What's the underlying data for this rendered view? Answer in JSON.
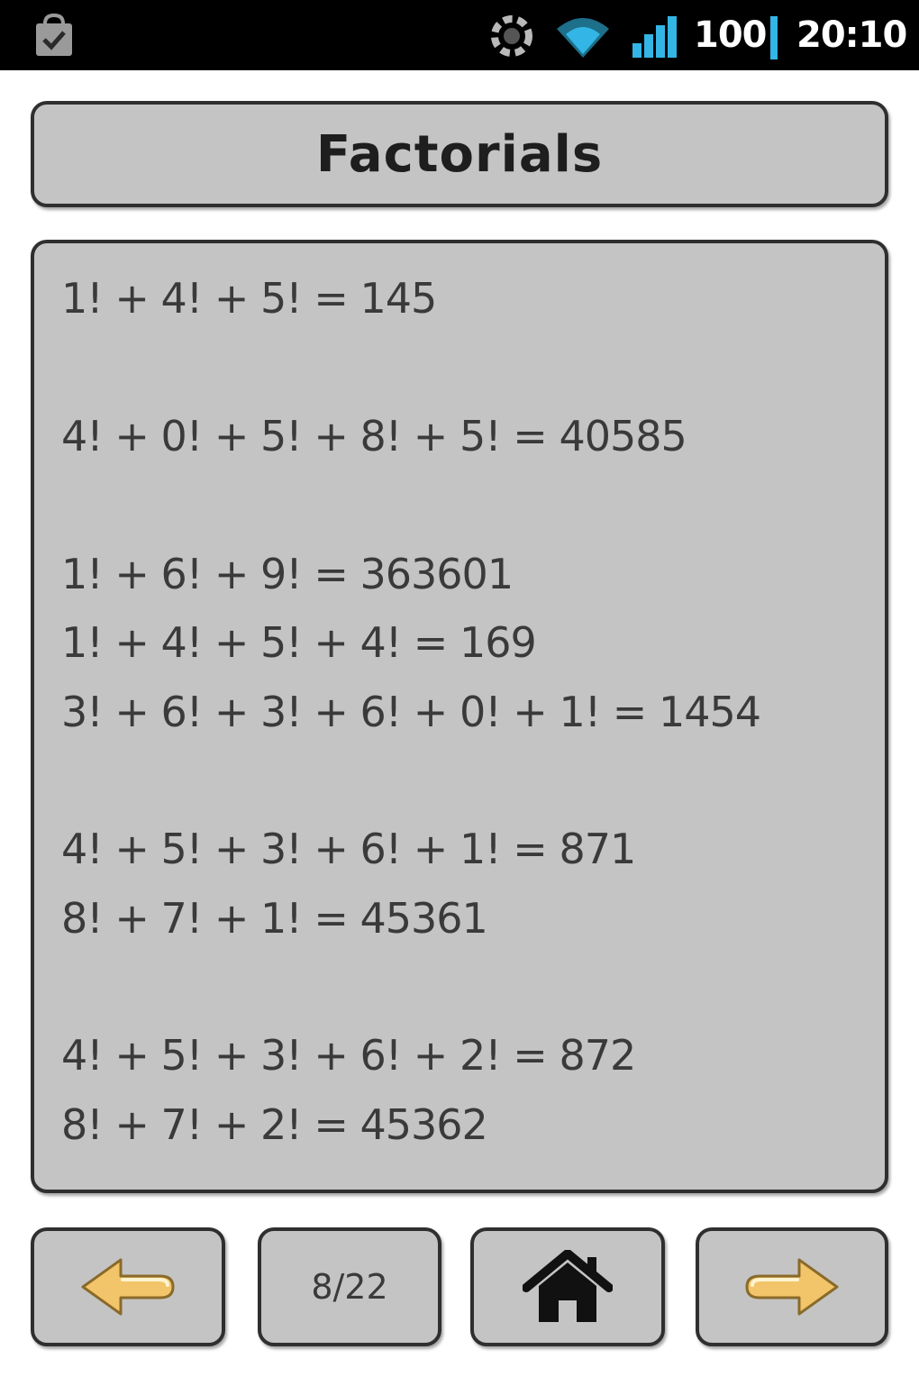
{
  "status_bar": {
    "battery": "100",
    "time": "20:10",
    "icons": [
      "shopping-bag-check-icon",
      "sync-icon",
      "wifi-icon",
      "signal-icon"
    ],
    "accent_color": "#33b5e5"
  },
  "header": {
    "title": "Factorials"
  },
  "content": {
    "equations": [
      "1! + 4! + 5! = 145",
      "4! + 0! + 5! + 8! + 5! = 40585",
      "1! + 6! + 9! = 363601",
      "1! + 4! + 5! + 4! = 169",
      "3! + 6! + 3! + 6! + 0! + 1! = 1454",
      "4! + 5! + 3! + 6! + 1! = 871",
      "8! + 7! + 1! = 45361",
      "4! + 5! + 3! + 6! + 2! = 872",
      "8! + 7! + 2! = 45362"
    ]
  },
  "navigation": {
    "prev_icon": "arrow-left-icon",
    "page_indicator": "8/22",
    "home_icon": "home-icon",
    "next_icon": "arrow-right-icon"
  },
  "colors": {
    "panel_fill": "#c4c4c4",
    "panel_border": "#2f2f2f",
    "arrow_fill": "#f2c56a"
  }
}
